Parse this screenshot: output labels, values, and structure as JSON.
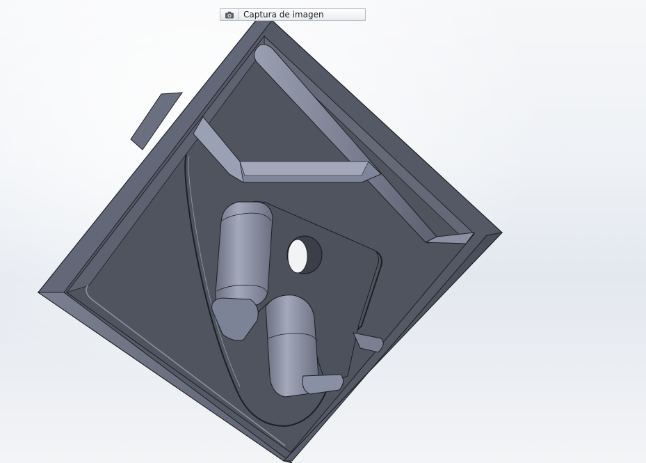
{
  "toolbar": {
    "capture_label": "Captura de imagen",
    "capture_icon": "camera-icon"
  },
  "colors": {
    "face_dark": "#4f535f",
    "face_mid": "#6d7282",
    "face_light": "#8f95a8",
    "edge": "#1c1e24"
  }
}
